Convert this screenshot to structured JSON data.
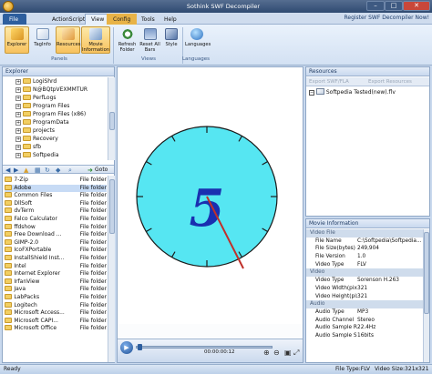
{
  "window": {
    "title": "Sothink SWF Decompiler"
  },
  "menu": {
    "tabs": [
      "File",
      "ActionScript",
      "View",
      "Config",
      "Tools",
      "Help"
    ],
    "help_link": "Register SWF Decompiler Now!"
  },
  "ribbon": {
    "buttons": [
      {
        "label": "Explorer",
        "icon": "explorer-icon"
      },
      {
        "label": "TagInfo",
        "icon": "taginfo-icon"
      },
      {
        "label": "Resources",
        "icon": "resources-icon"
      },
      {
        "label": "Movie Information",
        "icon": "movie-info-icon"
      },
      {
        "label": "Refresh Folder",
        "icon": "refresh-icon"
      },
      {
        "label": "Reset All Bars",
        "icon": "reset-bars-icon"
      },
      {
        "label": "Style",
        "icon": "style-icon"
      },
      {
        "label": "Languages",
        "icon": "globe-icon"
      }
    ],
    "groups": [
      "Panels",
      "Views",
      "Languages"
    ]
  },
  "explorer": {
    "title": "Explorer",
    "tree": [
      "LogiShrd",
      "N@BQtpVEXMMTUR",
      "PerfLogs",
      "Program Files",
      "Program Files (x86)",
      "ProgramData",
      "projects",
      "Recovery",
      "sfb",
      "Softpedia"
    ],
    "goto_label": "Goto",
    "files": [
      {
        "name": "7-Zip",
        "type": "File folder"
      },
      {
        "name": "Adobe",
        "type": "File folder"
      },
      {
        "name": "Common Files",
        "type": "File folder"
      },
      {
        "name": "DllSoft",
        "type": "File folder"
      },
      {
        "name": "dvTerm",
        "type": "File folder"
      },
      {
        "name": "Falco Calculator",
        "type": "File folder"
      },
      {
        "name": "ffdshow",
        "type": "File folder"
      },
      {
        "name": "Free Download ...",
        "type": "File folder"
      },
      {
        "name": "GIMP-2.0",
        "type": "File folder"
      },
      {
        "name": "IcoFXPortable",
        "type": "File folder"
      },
      {
        "name": "InstallShield Inst...",
        "type": "File folder"
      },
      {
        "name": "Intel",
        "type": "File folder"
      },
      {
        "name": "Internet Explorer",
        "type": "File folder"
      },
      {
        "name": "IrfanView",
        "type": "File folder"
      },
      {
        "name": "Java",
        "type": "File folder"
      },
      {
        "name": "LabPacks",
        "type": "File folder"
      },
      {
        "name": "Logitech",
        "type": "File folder"
      },
      {
        "name": "Microsoft Access...",
        "type": "File folder"
      },
      {
        "name": "Microsoft CAPI...",
        "type": "File folder"
      },
      {
        "name": "Microsoft Office",
        "type": "File folder"
      }
    ]
  },
  "player": {
    "time": "00:00:00:12",
    "clock_number": "5"
  },
  "resources": {
    "title": "Resources",
    "export_label": "Export SWF/FLA",
    "extract_label": "Export Resources",
    "item": "Softpedia Tested(new).flv"
  },
  "movie_info": {
    "title": "Movie Information",
    "sections": [
      {
        "name": "Video File",
        "rows": [
          {
            "k": "File Name",
            "v": "C:\\Softpedia\\Softpedia..."
          },
          {
            "k": "File Size(bytes)",
            "v": "249,904"
          },
          {
            "k": "File Version",
            "v": "1.0"
          },
          {
            "k": "Video Type",
            "v": "FLV"
          }
        ]
      },
      {
        "name": "Video",
        "rows": [
          {
            "k": "Video Type",
            "v": "Sorenson H.263"
          },
          {
            "k": "Video Width(pixels)",
            "v": "321"
          },
          {
            "k": "Video Height(pixels)",
            "v": "321"
          }
        ]
      },
      {
        "name": "Audio",
        "rows": [
          {
            "k": "Audio Type",
            "v": "MP3"
          },
          {
            "k": "Audio Channel",
            "v": "Stereo"
          },
          {
            "k": "Audio Sample Rate",
            "v": "22.4Hz"
          },
          {
            "k": "Audio Sample Size",
            "v": "16bits"
          }
        ]
      }
    ]
  },
  "status": {
    "left": "Ready",
    "file_type": "File Type:FLV",
    "video_size": "Video Size:321x321"
  },
  "colors": {
    "clock_face": "#56e6f2",
    "clock_digit": "#1a2fb0",
    "hand": "#c0302a",
    "accent": "#f7c25e"
  }
}
